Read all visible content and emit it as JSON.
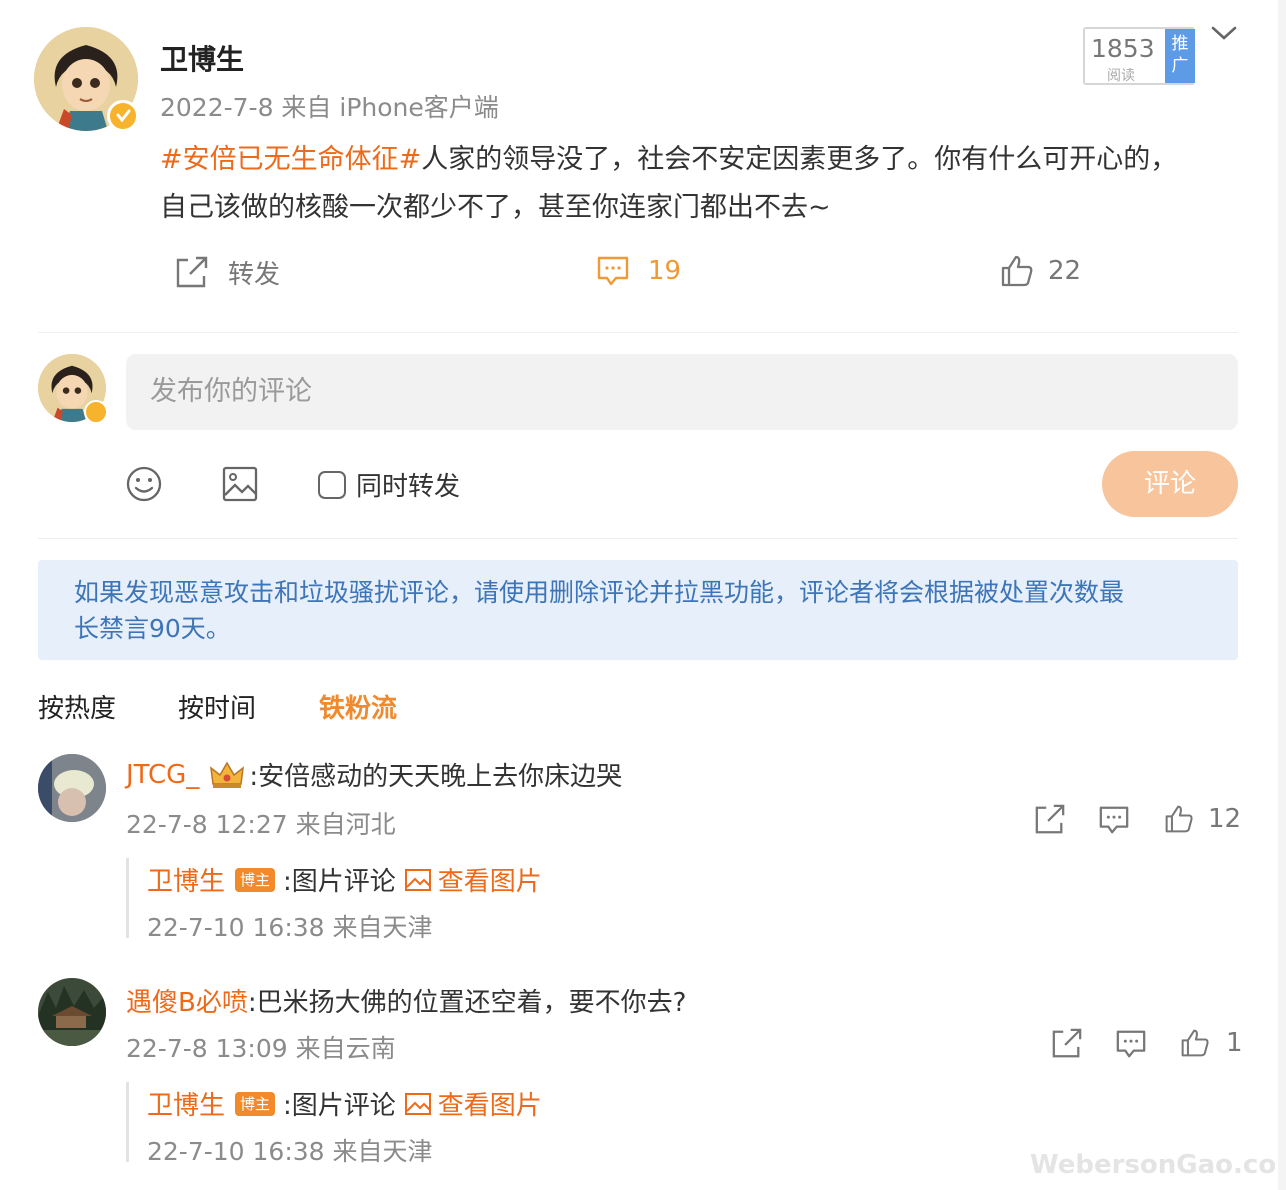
{
  "post": {
    "author": "卫博生",
    "meta": "2022-7-8 来自 iPhone客户端",
    "topic": "#安倍已无生命体征#",
    "text_line1": "人家的领导没了，社会不安定因素更多了。你有什么可开心的，",
    "text_line2": "自己该做的核酸一次都少不了，甚至你连家门都出不去~",
    "reads": "1853",
    "reads_label": "阅读",
    "promo_label": "推广",
    "actions": {
      "repost": "转发",
      "comments": "19",
      "likes": "22"
    }
  },
  "composer": {
    "placeholder": "发布你的评论",
    "repost_checkbox_label": "同时转发",
    "submit_label": "评论"
  },
  "notice": {
    "line1": "如果发现恶意攻击和垃圾骚扰评论，请使用删除评论并拉黑功能，评论者将会根据被处置次数最",
    "line2": "长禁言90天。"
  },
  "sort_tabs": [
    {
      "label": "按热度"
    },
    {
      "label": "按时间"
    },
    {
      "label": "铁粉流"
    }
  ],
  "comments": [
    {
      "user": "JTCG_",
      "text": ":安倍感动的天天晚上去你床边哭",
      "time": "22-7-8 12:27 来自河北",
      "likes": "12",
      "reply": {
        "user": "卫博生",
        "badge": "博主",
        "text": ":图片评论",
        "link": "查看图片",
        "time": "22-7-10 16:38 来自天津"
      }
    },
    {
      "user": "遇傻B必喷",
      "text": ":巴米扬大佛的位置还空着，要不你去?",
      "time": "22-7-8 13:09 来自云南",
      "likes": "1",
      "reply": {
        "user": "卫博生",
        "badge": "博主",
        "text": ":图片评论",
        "link": "查看图片",
        "time": "22-7-10 16:38 来自天津"
      }
    }
  ],
  "watermark": "WebersonGao.com",
  "colors": {
    "accent": "#ec6a1a",
    "verified": "#f6b32b",
    "notice_bg": "#e6effa",
    "notice_text": "#3d75b8"
  }
}
